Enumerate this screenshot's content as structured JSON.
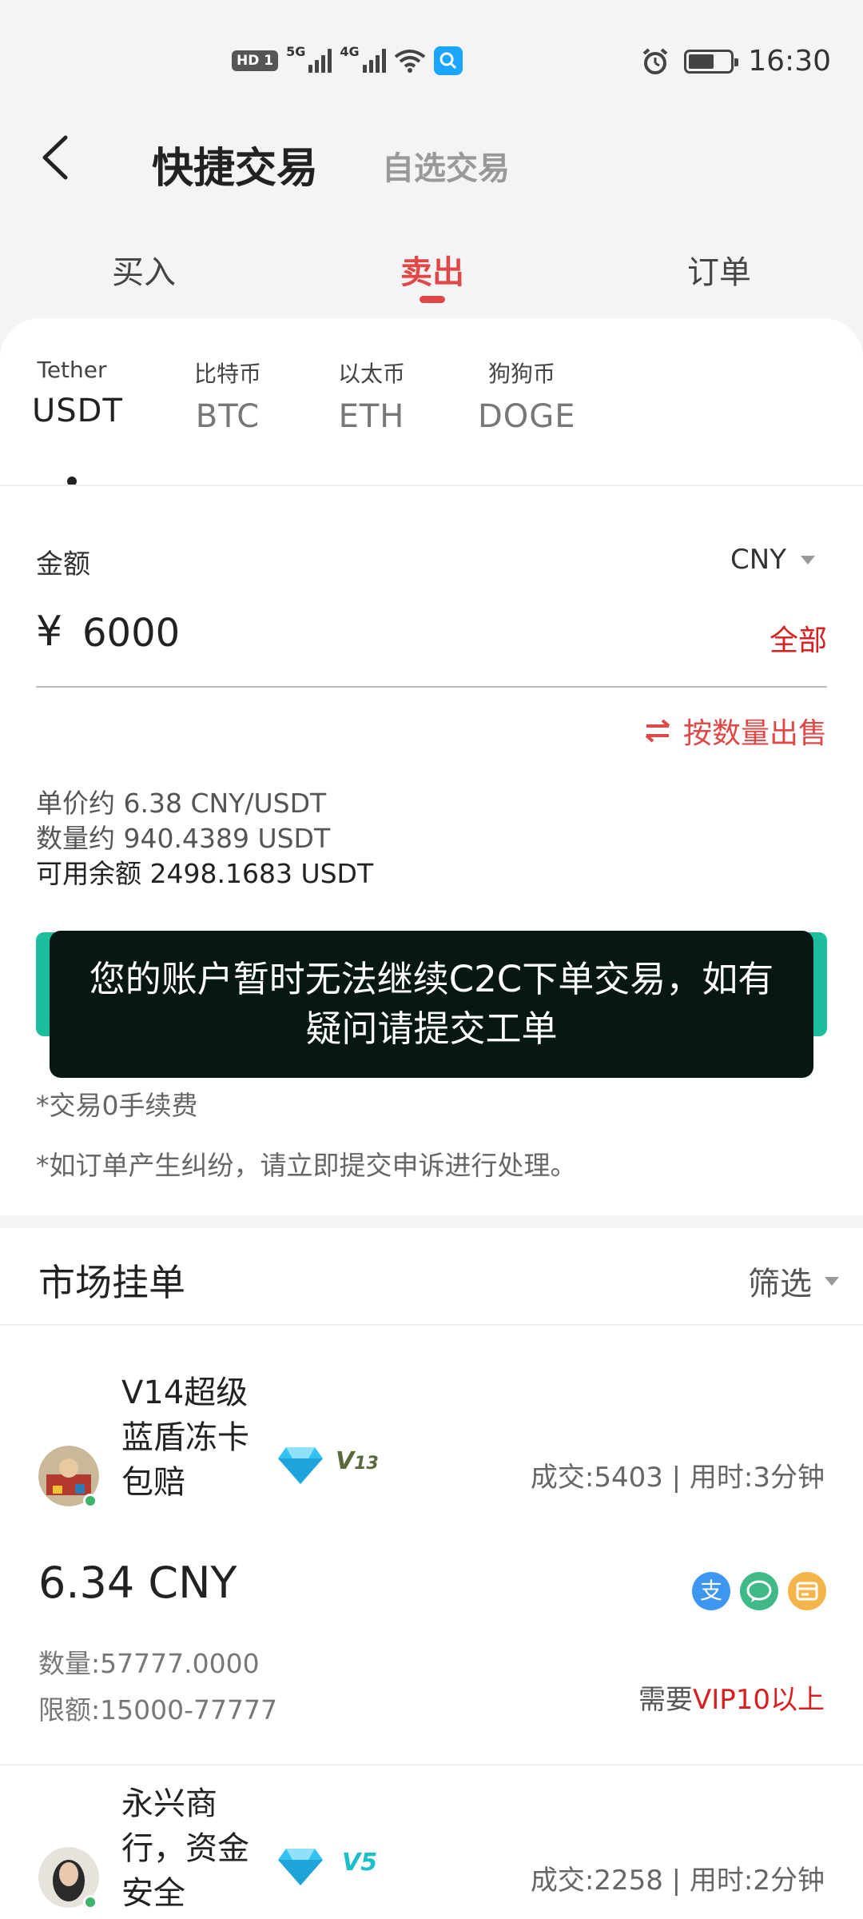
{
  "status_bar": {
    "hd_label": "HD",
    "sim_label": "1",
    "net1": "5G",
    "net2": "4G",
    "time": "16:30",
    "icons": [
      "signal-icon",
      "wifi-icon",
      "search-app-icon",
      "alarm-icon",
      "battery-icon"
    ]
  },
  "nav": {
    "title": "快捷交易",
    "alt_mode": "自选交易"
  },
  "tabs": [
    {
      "label": "买入"
    },
    {
      "label": "卖出"
    },
    {
      "label": "订单"
    }
  ],
  "coins": [
    {
      "sub": "Tether",
      "code": "USDT"
    },
    {
      "sub": "比特币",
      "code": "BTC"
    },
    {
      "sub": "以太币",
      "code": "ETH"
    },
    {
      "sub": "狗狗币",
      "code": "DOGE"
    }
  ],
  "form": {
    "amount_label": "金额",
    "currency": "CNY",
    "yen_symbol": "¥",
    "amount_value": "6000",
    "all_label": "全部",
    "unit_price_label": "单价约",
    "unit_price_value": "6.38 CNY/USDT",
    "quantity_label": "数量约",
    "quantity_value": "940.4389 USDT",
    "balance_label": "可用余额",
    "balance_value": "2498.1683 USDT",
    "switch_label": "按数量出售"
  },
  "toast": {
    "message": "您的账户暂时无法继续C2C下单交易，如有疑问请提交工单"
  },
  "notes": {
    "fee_note": "*交易0手续费",
    "dispute_note": "*如订单产生纠纷，请立即提交申诉进行处理。"
  },
  "market": {
    "title": "市场挂单",
    "filter_label": "筛选",
    "listings": [
      {
        "name_lines": [
          "V14超级",
          "蓝盾冻卡",
          "包赔"
        ],
        "level": "13",
        "stats": "成交:5403 | 用时:3分钟",
        "price": "6.34 CNY",
        "quantity": "数量:57777.0000",
        "limit": "限额:15000-77777",
        "vip_prefix": "需要",
        "vip_required": "VIP10以上",
        "pay_alipay": "支"
      },
      {
        "name_lines": [
          "永兴商",
          "行，资金",
          "安全"
        ],
        "level": "5",
        "stats": "成交:2258 | 用时:2分钟"
      }
    ]
  },
  "colors": {
    "accent_red": "#e04848",
    "sell_green": "#1bbf9e",
    "toast_bg": "#071714",
    "alipay_blue": "#3d97f0",
    "wechat_green": "#3fb987",
    "card_orange": "#f5b44a"
  }
}
